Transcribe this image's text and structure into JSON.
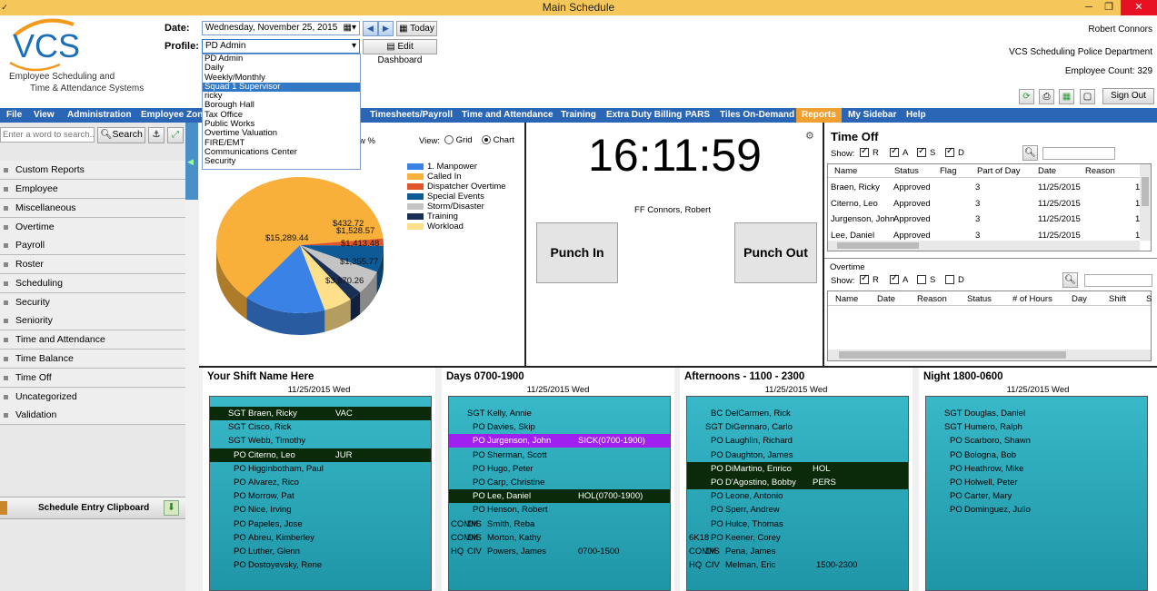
{
  "window": {
    "title": "Main Schedule",
    "min": "─",
    "max": "❐",
    "close": "✕"
  },
  "header": {
    "logo": "VCS",
    "tagline1": "Employee Scheduling and",
    "tagline2": "Time & Attendance Systems",
    "date_label": "Date:",
    "date_value": "Wednesday, November 25, 2015",
    "today": "Today",
    "profile_label": "Profile:",
    "profile_value": "PD Admin",
    "edit_dashboard": "Edit Dashboard",
    "user": "Robert Connors",
    "org": "VCS Scheduling Police Department",
    "employee_count": "Employee Count: 329",
    "sign_out": "Sign Out"
  },
  "profile_options": [
    "PD Admin",
    "Daily",
    "Weekly/Monthly",
    "Squad 1 Supervisor",
    "ricky",
    "Borough Hall",
    "Tax Office",
    "Public Works",
    "Overtime Valuation",
    "FIRE/EMT",
    "Communications Center",
    "Security"
  ],
  "menu": [
    "File",
    "View",
    "Administration",
    "Employee Zone",
    "Timesheets/Payroll",
    "Time and Attendance",
    "Training",
    "Extra Duty Billing",
    "PARS",
    "Tiles On-Demand",
    "Reports",
    "My Sidebar",
    "Help"
  ],
  "sidebar": {
    "search_placeholder": "Enter a word to search...",
    "search_button": "Search",
    "items": [
      "Custom Reports",
      "Employee",
      "Miscellaneous",
      "Overtime",
      "Payroll",
      "Roster",
      "Scheduling",
      "Security",
      "Seniority",
      "Time and Attendance",
      "Time Balance",
      "Time Off",
      "Uncategorized",
      "Validation"
    ],
    "clipboard": "Schedule Entry Clipboard"
  },
  "chart_panel": {
    "view_label": "View:",
    "grid": "Grid",
    "chart": "Chart",
    "pct": "w %"
  },
  "chart_data": {
    "type": "pie",
    "series": [
      {
        "name": "1. Manpower",
        "value": 3870.26,
        "label": "$3,870.26",
        "color": "#3b82e6"
      },
      {
        "name": "Called In",
        "value": 15289.44,
        "label": "$15,289.44",
        "color": "#f8b03a"
      },
      {
        "name": "Dispatcher Overtime",
        "value": 432.72,
        "label": "$432.72",
        "color": "#e0542a"
      },
      {
        "name": "Special Events",
        "value": 1528.57,
        "label": "$1,528.57",
        "color": "#0e5a96"
      },
      {
        "name": "Storm/Disaster",
        "value": 1413.48,
        "label": "$1,413.48",
        "color": "#c4c4c4"
      },
      {
        "name": "Training",
        "value": 600,
        "label": "",
        "color": "#1a2f55"
      },
      {
        "name": "Workload",
        "value": 1355.77,
        "label": "$1,355.77",
        "color": "#ffe08a"
      }
    ]
  },
  "clock": {
    "time": "16:11:59",
    "employee": "FF Connors, Robert",
    "punch_in": "Punch In",
    "punch_out": "Punch Out"
  },
  "time_off": {
    "title": "Time Off",
    "show": "Show:",
    "filters": [
      {
        "k": "R",
        "on": true
      },
      {
        "k": "A",
        "on": true
      },
      {
        "k": "S",
        "on": true
      },
      {
        "k": "D",
        "on": true
      }
    ],
    "columns": [
      "Name",
      "Status",
      "Flag",
      "Part of Day",
      "Date",
      "Reason"
    ],
    "rows": [
      [
        "Braen, Ricky",
        "Approved",
        "",
        "3",
        "11/25/2015",
        "1"
      ],
      [
        "Citerno, Leo",
        "Approved",
        "",
        "3",
        "11/25/2015",
        "1"
      ],
      [
        "Jurgenson, John",
        "Approved",
        "",
        "3",
        "11/25/2015",
        "1"
      ],
      [
        "Lee, Daniel",
        "Approved",
        "",
        "3",
        "11/25/2015",
        "1"
      ]
    ]
  },
  "overtime": {
    "title": "Overtime",
    "show": "Show:",
    "filters": [
      {
        "k": "R",
        "on": true
      },
      {
        "k": "A",
        "on": true
      },
      {
        "k": "S",
        "on": false
      },
      {
        "k": "D",
        "on": false
      }
    ],
    "columns": [
      "Name",
      "Date",
      "Reason",
      "Status",
      "# of Hours",
      "Day",
      "Shift",
      "S"
    ]
  },
  "shifts": [
    {
      "title": "Your Shift Name Here",
      "date": "11/25/2015 Wed",
      "rows": [
        [
          "",
          "SGT",
          "Braen, Ricky",
          "VAC",
          "dark"
        ],
        [
          "",
          "SGT",
          "Cisco, Rick",
          "",
          ""
        ],
        [
          "",
          "SGT",
          "Webb, Timothy",
          "",
          ""
        ],
        [
          "",
          "PO",
          "Citerno, Leo",
          "JUR",
          "dark"
        ],
        [
          "",
          "PO",
          "Higginbotham, Paul",
          "",
          ""
        ],
        [
          "",
          "PO",
          "Alvarez, Rico",
          "",
          ""
        ],
        [
          "",
          "PO",
          "Morrow, Pat",
          "",
          ""
        ],
        [
          "",
          "PO",
          "Nice, Irving",
          "",
          ""
        ],
        [
          "",
          "PO",
          "Papeles, Jose",
          "",
          ""
        ],
        [
          "",
          "PO",
          "Abreu, Kimberley",
          "",
          ""
        ],
        [
          "",
          "PO",
          "Luther, Glenn",
          "",
          ""
        ],
        [
          "",
          "PO",
          "Dostoyevsky, Rene",
          "",
          ""
        ]
      ]
    },
    {
      "title": "Days 0700-1900",
      "date": "11/25/2015 Wed",
      "rows": [
        [
          "",
          "SGT",
          "Kelly, Annie",
          "",
          ""
        ],
        [
          "",
          "PO",
          "Davies, Skip",
          "",
          ""
        ],
        [
          "",
          "PO",
          "Jurgenson, John",
          "SICK(0700-1900)",
          "purple"
        ],
        [
          "",
          "PO",
          "Sherman, Scott",
          "",
          ""
        ],
        [
          "",
          "PO",
          "Hugo, Peter",
          "",
          ""
        ],
        [
          "",
          "PO",
          "Carp, Christine",
          "",
          ""
        ],
        [
          "",
          "PO",
          "Lee, Daniel",
          "HOL(0700-1900)",
          "dark"
        ],
        [
          "",
          "PO",
          "Henson, Robert",
          "",
          ""
        ],
        [
          "COMM",
          "DIS",
          "Smith, Reba",
          "",
          ""
        ],
        [
          "COMM",
          "DIS",
          "Morton, Kathy",
          "",
          ""
        ],
        [
          "HQ",
          "CIV",
          "Powers, James",
          "0700-1500",
          ""
        ]
      ]
    },
    {
      "title": "Afternoons - 1100 - 2300",
      "date": "11/25/2015 Wed",
      "rows": [
        [
          "",
          "BC",
          "DelCarmen, Rick",
          "",
          ""
        ],
        [
          "",
          "SGT",
          "DiGennaro, Carlo",
          "",
          ""
        ],
        [
          "",
          "PO",
          "Laughlin, Richard",
          "",
          ""
        ],
        [
          "",
          "PO",
          "Daughton, James",
          "",
          ""
        ],
        [
          "",
          "PO",
          "DiMartino, Enrico",
          "HOL",
          "dark"
        ],
        [
          "",
          "PO",
          "D'Agostino, Bobby",
          "PERS",
          "dark"
        ],
        [
          "",
          "PO",
          "Leone, Antonio",
          "",
          ""
        ],
        [
          "",
          "PO",
          "Sperr, Andrew",
          "",
          ""
        ],
        [
          "",
          "PO",
          "Hulce, Thomas",
          "",
          ""
        ],
        [
          "6K18",
          "PO",
          "Keener, Corey",
          "",
          ""
        ],
        [
          "COMM",
          "DIS",
          "Pena, James",
          "",
          ""
        ],
        [
          "HQ",
          "CIV",
          "Melman, Eric",
          "1500-2300",
          ""
        ]
      ]
    },
    {
      "title": "Night 1800-0600",
      "date": "11/25/2015 Wed",
      "rows": [
        [
          "",
          "SGT",
          "Douglas, Daniel",
          "",
          ""
        ],
        [
          "",
          "SGT",
          "Humero, Ralph",
          "",
          ""
        ],
        [
          "",
          "PO",
          "Scarboro, Shawn",
          "",
          ""
        ],
        [
          "",
          "PO",
          "Bologna, Bob",
          "",
          ""
        ],
        [
          "",
          "PO",
          "Heathrow, Mike",
          "",
          ""
        ],
        [
          "",
          "PO",
          "Holwell, Peter",
          "",
          ""
        ],
        [
          "",
          "PO",
          "Carter, Mary",
          "",
          ""
        ],
        [
          "",
          "PO",
          "Dominguez, Julio",
          "",
          ""
        ]
      ]
    }
  ]
}
